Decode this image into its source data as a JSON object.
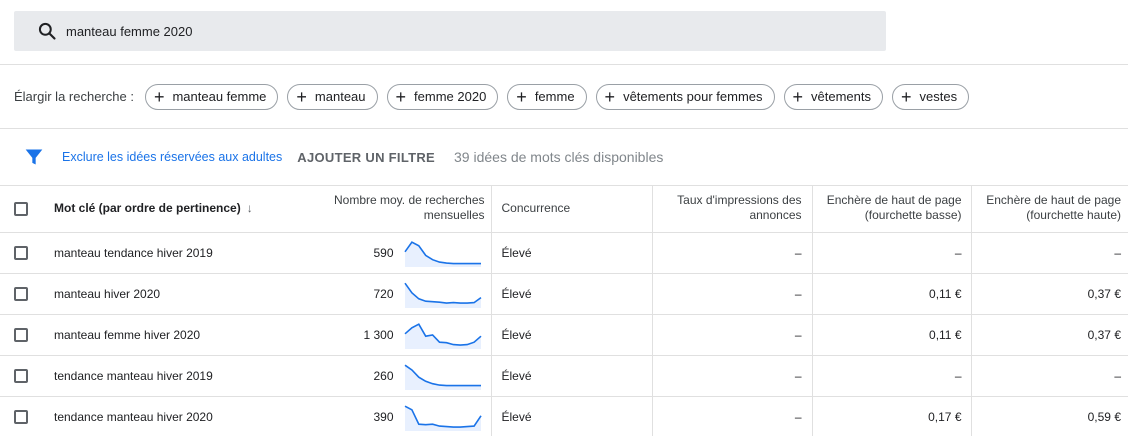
{
  "search": {
    "query": "manteau femme 2020"
  },
  "broaden": {
    "label": "Élargir la recherche :",
    "chips": [
      "manteau femme",
      "manteau",
      "femme 2020",
      "femme",
      "vêtements pour femmes",
      "vêtements",
      "vestes"
    ]
  },
  "filters": {
    "exclude_adult": "Exclure les idées réservées aux adultes",
    "add_filter": "AJOUTER UN FILTRE",
    "count_text": "39 idées de mots clés disponibles"
  },
  "table": {
    "headers": {
      "keyword": "Mot clé (par ordre de pertinence)",
      "volume_line1": "Nombre moy. de recherches",
      "volume_line2": "mensuelles",
      "competition": "Concurrence",
      "impressions_line1": "Taux d'impressions des",
      "impressions_line2": "annonces",
      "bid_low_line1": "Enchère de haut de page",
      "bid_low_line2": "(fourchette basse)",
      "bid_high_line1": "Enchère de haut de page",
      "bid_high_line2": "(fourchette haute)"
    },
    "rows": [
      {
        "keyword": "manteau tendance hiver 2019",
        "volume": "590",
        "competition": "Élevé",
        "impressions": "–",
        "bid_low": "–",
        "bid_high": "–",
        "trend": [
          0.55,
          0.95,
          0.8,
          0.4,
          0.22,
          0.12,
          0.08,
          0.06,
          0.06,
          0.06,
          0.06,
          0.06
        ]
      },
      {
        "keyword": "manteau hiver 2020",
        "volume": "720",
        "competition": "Élevé",
        "impressions": "–",
        "bid_low": "0,11 €",
        "bid_high": "0,37 €",
        "trend": [
          0.95,
          0.55,
          0.3,
          0.2,
          0.18,
          0.16,
          0.12,
          0.14,
          0.12,
          0.12,
          0.14,
          0.35
        ]
      },
      {
        "keyword": "manteau femme hiver 2020",
        "volume": "1 300",
        "competition": "Élevé",
        "impressions": "–",
        "bid_low": "0,11 €",
        "bid_high": "0,37 €",
        "trend": [
          0.55,
          0.8,
          0.95,
          0.45,
          0.5,
          0.2,
          0.18,
          0.1,
          0.08,
          0.1,
          0.2,
          0.45
        ]
      },
      {
        "keyword": "tendance manteau hiver 2019",
        "volume": "260",
        "competition": "Élevé",
        "impressions": "–",
        "bid_low": "–",
        "bid_high": "–",
        "trend": [
          0.95,
          0.75,
          0.45,
          0.28,
          0.18,
          0.12,
          0.1,
          0.1,
          0.1,
          0.1,
          0.1,
          0.1
        ]
      },
      {
        "keyword": "tendance manteau hiver 2020",
        "volume": "390",
        "competition": "Élevé",
        "impressions": "–",
        "bid_low": "0,17 €",
        "bid_high": "0,59 €",
        "trend": [
          0.95,
          0.8,
          0.2,
          0.18,
          0.2,
          0.12,
          0.1,
          0.08,
          0.08,
          0.1,
          0.12,
          0.55
        ]
      }
    ]
  },
  "colors": {
    "accent": "#1a73e8",
    "spark_fill": "#e8f0fe"
  }
}
